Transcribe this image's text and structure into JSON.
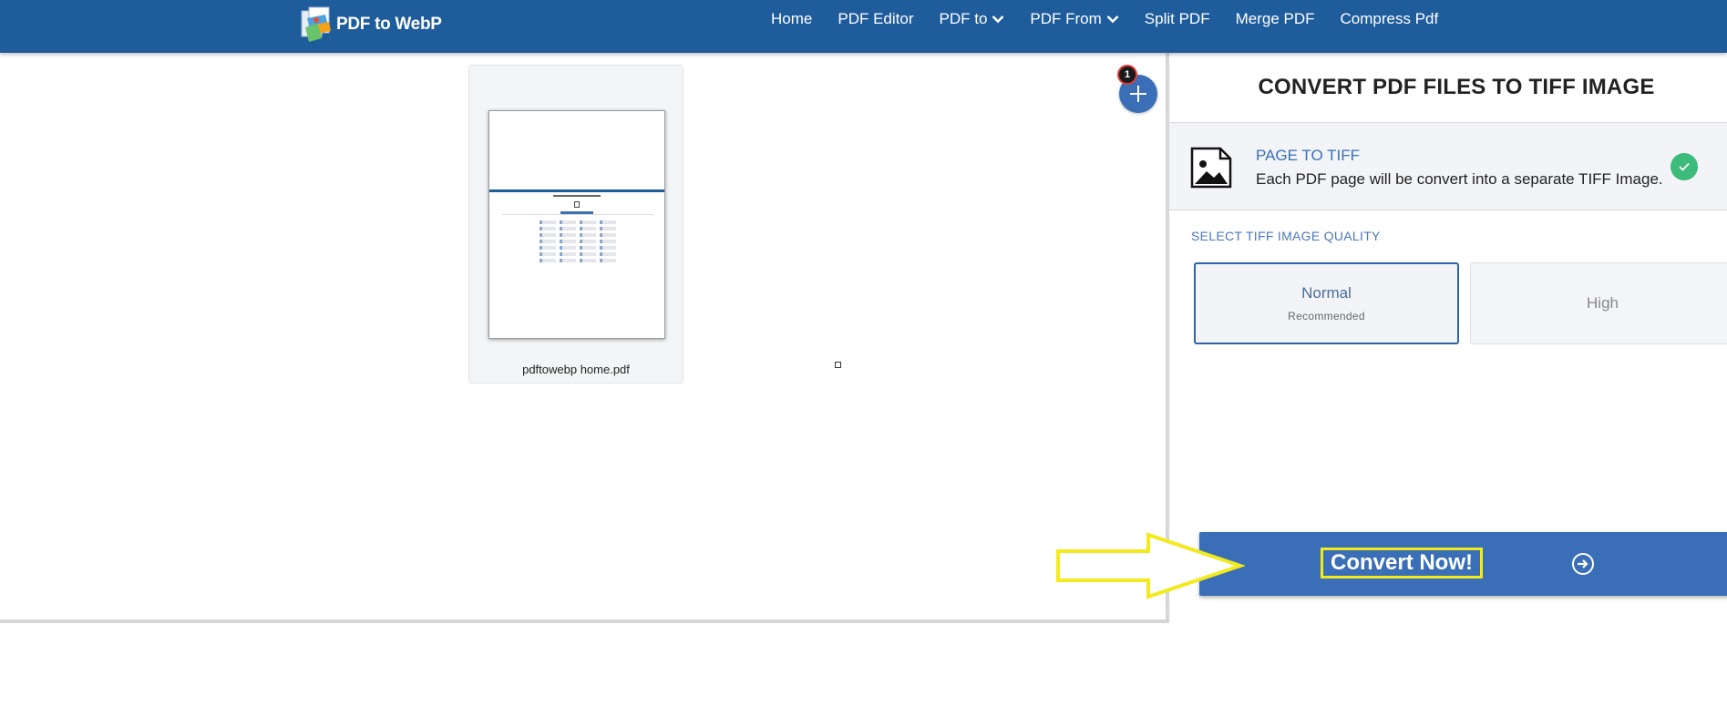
{
  "brand": {
    "name": "PDF to WebP"
  },
  "nav": {
    "items": [
      {
        "label": "Home",
        "dropdown": false
      },
      {
        "label": "PDF Editor",
        "dropdown": false
      },
      {
        "label": "PDF to",
        "dropdown": true
      },
      {
        "label": "PDF From",
        "dropdown": true
      },
      {
        "label": "Split PDF",
        "dropdown": false
      },
      {
        "label": "Merge PDF",
        "dropdown": false
      },
      {
        "label": "Compress Pdf",
        "dropdown": false
      }
    ]
  },
  "workspace": {
    "file": {
      "name": "pdftowebp home.pdf"
    },
    "add_button_icon": "plus-icon",
    "file_count_badge": "1"
  },
  "panel": {
    "title": "CONVERT PDF FILES TO TIFF IMAGE",
    "mode": {
      "title": "PAGE TO TIFF",
      "description": "Each PDF page will be convert into a separate TIFF Image.",
      "selected": true
    },
    "quality": {
      "label": "SELECT TIFF IMAGE QUALITY",
      "options": [
        {
          "name": "Normal",
          "sub": "Recommended",
          "selected": true
        },
        {
          "name": "High",
          "sub": "",
          "selected": false
        }
      ]
    },
    "convert": {
      "label": "Convert Now!"
    }
  },
  "colors": {
    "navbar": "#1f5c9c",
    "accent": "#3a6fb7",
    "success": "#3dbb7a",
    "highlight": "#f2ea1c"
  }
}
